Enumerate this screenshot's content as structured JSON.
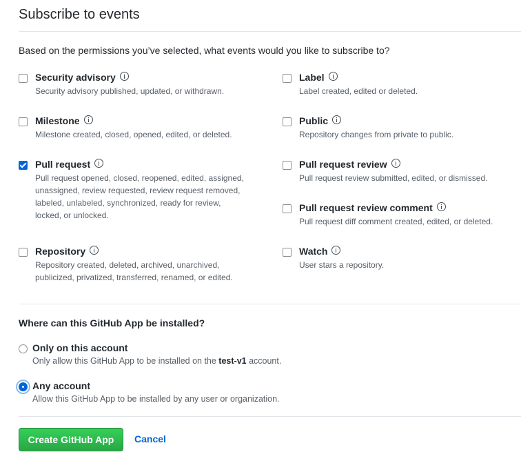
{
  "title": "Subscribe to events",
  "intro": "Based on the permissions you’ve selected, what events would you like to subscribe to?",
  "events": [
    {
      "name": "Security advisory",
      "desc": "Security advisory published, updated, or withdrawn.",
      "checked": false
    },
    {
      "name": "Label",
      "desc": "Label created, edited or deleted.",
      "checked": false
    },
    {
      "name": "Milestone",
      "desc": "Milestone created, closed, opened, edited, or deleted.",
      "checked": false
    },
    {
      "name": "Public",
      "desc": "Repository changes from private to public.",
      "checked": false
    },
    {
      "name": "Pull request",
      "desc_lines": [
        "Pull request opened, closed, reopened, edited, assigned,",
        "unassigned, review requested, review request removed,",
        "labeled, unlabeled, synchronized, ready for review,",
        "locked, or unlocked."
      ],
      "checked": true
    },
    {
      "name": "Pull request review",
      "desc": "Pull request review submitted, edited, or dismissed.",
      "checked": false
    },
    {
      "name": "Pull request review comment",
      "desc": "Pull request diff comment created, edited, or deleted.",
      "checked": false
    },
    {
      "name": "Repository",
      "desc_lines": [
        "Repository created, deleted, archived, unarchived,",
        "publicized, privatized, transferred, renamed, or edited."
      ],
      "checked": false
    },
    {
      "name": "Watch",
      "desc": "User stars a repository.",
      "checked": false
    }
  ],
  "install": {
    "question": "Where can this GitHub App be installed?",
    "options": [
      {
        "label": "Only on this account",
        "desc_prefix": "Only allow this GitHub App to be installed on the ",
        "account": "test-v1",
        "desc_suffix": " account.",
        "selected": false
      },
      {
        "label": "Any account",
        "desc": "Allow this GitHub App to be installed by any user or organization.",
        "selected": true
      }
    ]
  },
  "buttons": {
    "create": "Create GitHub App",
    "cancel": "Cancel"
  }
}
